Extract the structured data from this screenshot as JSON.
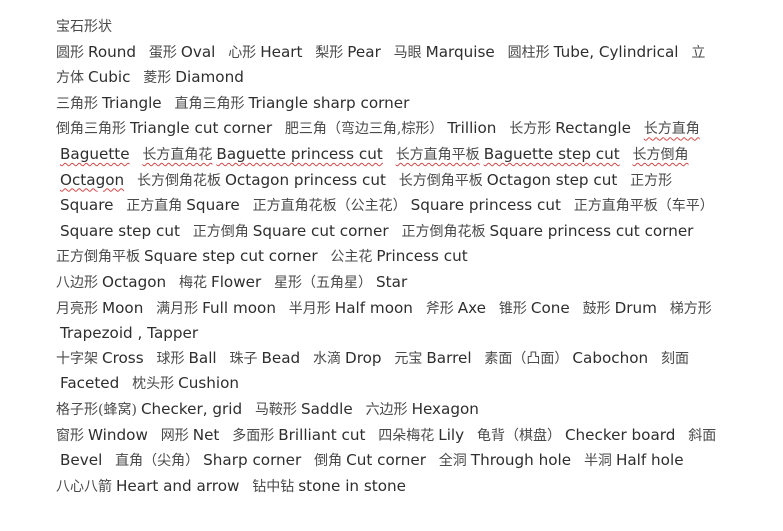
{
  "heading": "宝石形状",
  "lines": [
    {
      "segments": [
        {
          "cn": "圆形",
          "en": "Round"
        },
        {
          "cn": "蛋形",
          "en": "Oval"
        },
        {
          "cn": "心形",
          "en": "Heart"
        },
        {
          "cn": "梨形",
          "en": "Pear"
        },
        {
          "cn": "马眼",
          "en": "Marquise"
        },
        {
          "cn": "圆柱形",
          "en": "Tube, Cylindrical"
        },
        {
          "cn": "立方体",
          "en": "Cubic"
        },
        {
          "cn": "菱形",
          "en": "Diamond"
        }
      ]
    },
    {
      "segments": [
        {
          "cn": "三角形",
          "en": "Triangle"
        },
        {
          "cn": "直角三角形",
          "en": "Triangle sharp corner"
        }
      ]
    },
    {
      "segments": [
        {
          "cn": "倒角三角形",
          "en": "Triangle cut corner"
        },
        {
          "cn": "肥三角（弯边三角,棕形）",
          "en": "Trillion"
        },
        {
          "cn": "长方形",
          "en": "Rectangle"
        },
        {
          "cn": "长方直角",
          "en": "Baguette",
          "wavy": true
        },
        {
          "cn": "长方直角花",
          "en": "Baguette princess cut",
          "wavy": true
        },
        {
          "cn": "长方直角平板",
          "en": "Baguette step cut",
          "wavy": true
        },
        {
          "cn": "长方倒角",
          "en": "Octagon",
          "wavy": true
        },
        {
          "cn": "长方倒角花板",
          "en": "Octagon princess cut"
        },
        {
          "cn": "长方倒角平板",
          "en": "Octagon step cut"
        },
        {
          "cn": "正方形",
          "en": "Square"
        },
        {
          "cn": "正方直角",
          "en": "Square"
        },
        {
          "cn": "正方直角花板（公主花）",
          "en": "Square princess cut"
        },
        {
          "cn": "正方直角平板（车平）",
          "en": "Square step cut"
        },
        {
          "cn": "正方倒角",
          "en": "Square cut corner"
        },
        {
          "cn": "正方倒角花板",
          "en": "Square princess cut corner"
        },
        {
          "cn": "正方倒角平板",
          "en": "Square step cut corner"
        },
        {
          "cn": "公主花",
          "en": "Princess cut"
        }
      ]
    },
    {
      "segments": [
        {
          "cn": "八边形",
          "en": "Octagon"
        },
        {
          "cn": "梅花",
          "en": "Flower"
        },
        {
          "cn": "星形（五角星）",
          "en": "Star"
        }
      ]
    },
    {
      "segments": [
        {
          "cn": "月亮形",
          "en": "Moon"
        },
        {
          "cn": "满月形",
          "en": "Full moon"
        },
        {
          "cn": "半月形",
          "en": "Half moon"
        },
        {
          "cn": "斧形",
          "en": "Axe"
        },
        {
          "cn": "锥形",
          "en": "Cone"
        },
        {
          "cn": "鼓形",
          "en": "Drum"
        },
        {
          "cn": "梯方形",
          "en": "Trapezoid , Tapper"
        }
      ]
    },
    {
      "segments": [
        {
          "cn": "十字架",
          "en": "Cross"
        },
        {
          "cn": "球形",
          "en": "Ball"
        },
        {
          "cn": "珠子",
          "en": "Bead"
        },
        {
          "cn": "水滴",
          "en": "Drop"
        },
        {
          "cn": "元宝",
          "en": "Barrel"
        },
        {
          "cn": "素面（凸面）",
          "en": "Cabochon"
        },
        {
          "cn": "刻面",
          "en": "Faceted"
        },
        {
          "cn": "枕头形",
          "en": "Cushion"
        }
      ]
    },
    {
      "segments": [
        {
          "cn": "格子形(蜂窝)",
          "en": "Checker, grid"
        },
        {
          "cn": "马鞍形",
          "en": "Saddle"
        },
        {
          "cn": "六边形",
          "en": "Hexagon"
        }
      ]
    },
    {
      "segments": [
        {
          "cn": "窗形",
          "en": "Window"
        },
        {
          "cn": "网形",
          "en": "Net"
        },
        {
          "cn": "多面形",
          "en": "Brilliant cut"
        },
        {
          "cn": "四朵梅花",
          "en": "Lily"
        },
        {
          "cn": "龟背（棋盘）",
          "en": "Checker board"
        },
        {
          "cn": "斜面",
          "en": "Bevel"
        },
        {
          "cn": "直角（尖角）",
          "en": "Sharp corner"
        },
        {
          "cn": "倒角",
          "en": "Cut corner"
        },
        {
          "cn": "全洞",
          "en": "Through hole"
        },
        {
          "cn": "半洞",
          "en": "Half hole"
        }
      ]
    },
    {
      "segments": [
        {
          "cn": "八心八箭",
          "en": "Heart and arrow"
        },
        {
          "cn": "钻中钻",
          "en": "stone in stone"
        }
      ]
    }
  ]
}
